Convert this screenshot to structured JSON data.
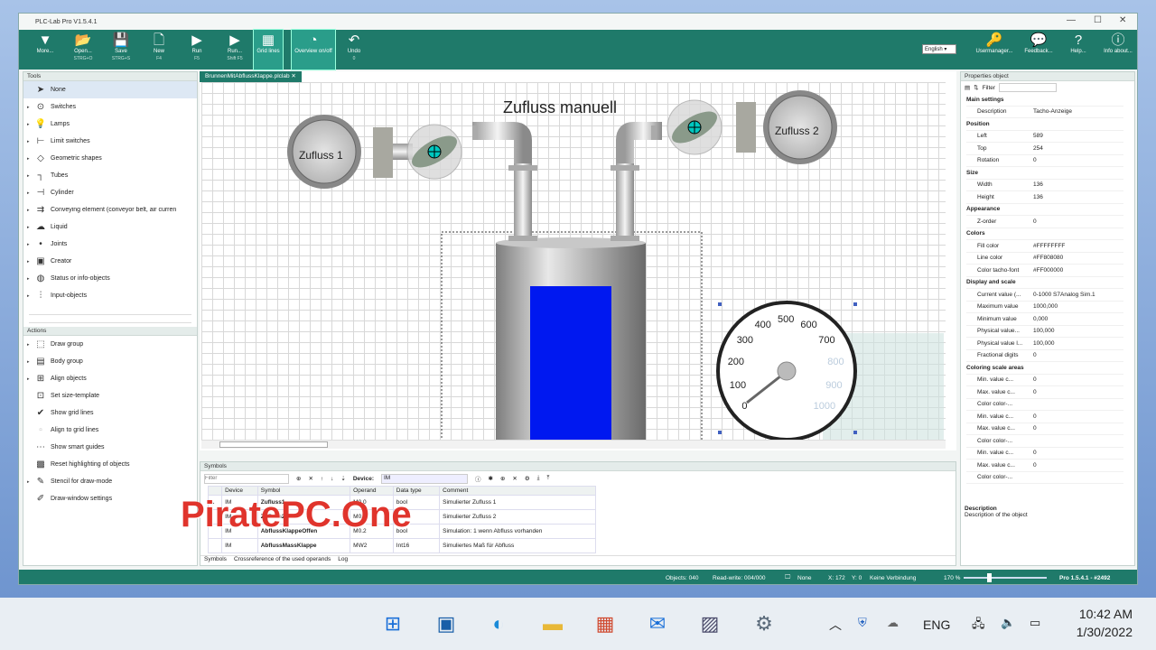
{
  "window": {
    "title": "PLC-Lab Pro V1.5.4.1"
  },
  "toolbar": {
    "buttons": [
      {
        "label": "More...",
        "shortcut": "",
        "icon": "caret-down-icon"
      },
      {
        "label": "Open...",
        "shortcut": "STRG+O",
        "icon": "folder-open-icon"
      },
      {
        "label": "Save",
        "shortcut": "STRG+S",
        "icon": "save-icon"
      },
      {
        "label": "New",
        "shortcut": "F4",
        "icon": "new-document-icon"
      },
      {
        "label": "Run",
        "shortcut": "F5",
        "icon": "play-icon"
      },
      {
        "label": "Run...",
        "shortcut": "Shift F5",
        "icon": "play-icon"
      },
      {
        "label": "Grid lines",
        "shortcut": "",
        "icon": "grid-icon",
        "active": true
      },
      {
        "label": "Overview on/off",
        "shortcut": "",
        "icon": "overview-icon",
        "active": true
      },
      {
        "label": "Undo",
        "shortcut": "0",
        "icon": "undo-icon"
      }
    ],
    "language": "English",
    "right_buttons": [
      {
        "label": "Usermanager...",
        "icon": "key-icon"
      },
      {
        "label": "Feedback...",
        "icon": "feedback-icon"
      },
      {
        "label": "Help...",
        "icon": "help-icon"
      },
      {
        "label": "Info about...",
        "icon": "info-icon"
      }
    ]
  },
  "tools": {
    "header": "Tools",
    "items": [
      "None",
      "Switches",
      "Lamps",
      "Limit switches",
      "Geometric shapes",
      "Tubes",
      "Cylinder",
      "Conveying element (conveyor belt, air curren",
      "Liquid",
      "Joints",
      "Creator",
      "Status or info-objects",
      "Input-objects"
    ]
  },
  "actions": {
    "header": "Actions",
    "items": [
      "Draw group",
      "Body group",
      "Align objects",
      "Set size-template",
      "Show grid lines",
      "Align to grid lines",
      "Show smart guides",
      "Reset highlighting of objects",
      "Stencil for draw-mode",
      "Draw-window settings"
    ]
  },
  "document": {
    "tab": "BrunnenMitAbflussKlappe.plclab",
    "canvas_title": "Zufluss manuell",
    "button1": "Zufluss 1",
    "button2": "Zufluss 2",
    "gauge_ticks": [
      "0",
      "100",
      "200",
      "300",
      "400",
      "500",
      "600",
      "700",
      "800",
      "900",
      "1000"
    ]
  },
  "symbols": {
    "header": "Symbols",
    "filter_placeholder": "Filter",
    "device_label": "Device:",
    "device_value": "IM",
    "columns": [
      "Device",
      "Symbol",
      "Operand",
      "Data type",
      "Comment"
    ],
    "rows": [
      {
        "device": "IM",
        "symbol": "Zufluss1",
        "operand": "M0.0",
        "type": "bool",
        "comment": "Simulierter Zufluss 1"
      },
      {
        "device": "IM",
        "symbol": "Zufluss2",
        "operand": "M0.1",
        "type": "bool",
        "comment": "Simulierter Zufluss 2"
      },
      {
        "device": "IM",
        "symbol": "AbflussKlappeOffen",
        "operand": "M0.2",
        "type": "bool",
        "comment": "Simulation: 1 wenn Abfluss vorhanden"
      },
      {
        "device": "IM",
        "symbol": "AbflussMassKlappe",
        "operand": "MW2",
        "type": "Int16",
        "comment": "Simuliertes Maß für Abfluss"
      }
    ],
    "tabs": [
      "Symbols",
      "Crossreference of the used operands",
      "Log"
    ]
  },
  "properties": {
    "header": "Properties object",
    "filter_label": "Filter",
    "rows": [
      {
        "k": "Main settings",
        "v": "",
        "h": 1
      },
      {
        "k": "Description",
        "v": "Tacho-Anzeige"
      },
      {
        "k": "Position",
        "v": "",
        "h": 1
      },
      {
        "k": "Left",
        "v": "589"
      },
      {
        "k": "Top",
        "v": "254"
      },
      {
        "k": "Rotation",
        "v": "0"
      },
      {
        "k": "Size",
        "v": "",
        "h": 1
      },
      {
        "k": "Width",
        "v": "136"
      },
      {
        "k": "Height",
        "v": "136"
      },
      {
        "k": "Appearance",
        "v": "",
        "h": 1
      },
      {
        "k": "Z-order",
        "v": "0"
      },
      {
        "k": "Colors",
        "v": "",
        "h": 1
      },
      {
        "k": "Fill color",
        "v": "#FFFFFFFF"
      },
      {
        "k": "Line color",
        "v": "#FF808080"
      },
      {
        "k": "Color tacho-font",
        "v": "#FF000000"
      },
      {
        "k": "Display and scale",
        "v": "",
        "h": 1
      },
      {
        "k": "Current value (...",
        "v": "0-1000 S7Analog Sim.1"
      },
      {
        "k": "Maximum value",
        "v": "1000,000"
      },
      {
        "k": "Minimum value",
        "v": "0,000"
      },
      {
        "k": "Physical value...",
        "v": "100,000"
      },
      {
        "k": "Physical value l...",
        "v": "100,000"
      },
      {
        "k": "Fractional digits",
        "v": "0"
      },
      {
        "k": "Coloring scale areas",
        "v": "",
        "h": 1
      },
      {
        "k": "Min. value c...",
        "v": "0"
      },
      {
        "k": "Max. value c...",
        "v": "0"
      },
      {
        "k": "Color color-...",
        "v": ""
      },
      {
        "k": "Min. value c...",
        "v": "0"
      },
      {
        "k": "Max. value c...",
        "v": "0"
      },
      {
        "k": "Color color-...",
        "v": ""
      },
      {
        "k": "Min. value c...",
        "v": "0"
      },
      {
        "k": "Max. value c...",
        "v": "0"
      },
      {
        "k": "Color color-...",
        "v": ""
      }
    ],
    "desc_title": "Description",
    "desc_text": "Description of the object"
  },
  "status": {
    "objects": "Objects: 040",
    "rw": "Read-write: 004/000",
    "none": "None",
    "x": "X: 172",
    "y": "Y: 0",
    "conn": "Keine Verbindung",
    "zoom": "170 %",
    "version": "Pro 1.5.4.1 - #2492"
  },
  "watermark": "PiratePC.One",
  "taskbar": {
    "lang": "ENG",
    "time": "10:42 AM",
    "date": "1/30/2022"
  }
}
